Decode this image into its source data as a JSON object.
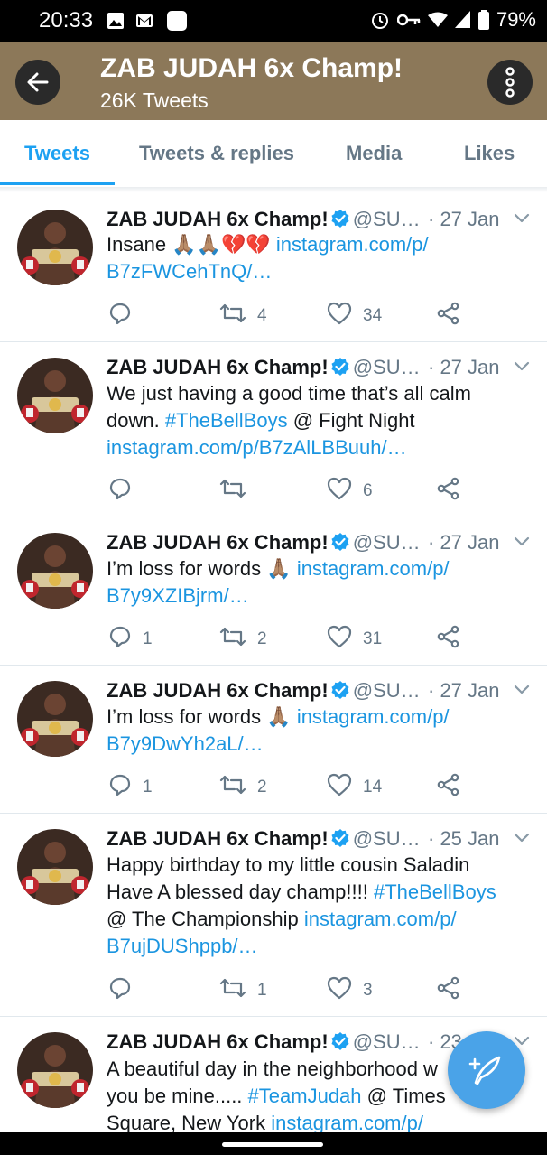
{
  "status_bar": {
    "time": "20:33",
    "battery": "79%"
  },
  "header": {
    "title": "ZAB JUDAH 6x Champ!",
    "subtitle": "26K Tweets"
  },
  "tabs": [
    {
      "label": "Tweets",
      "active": true
    },
    {
      "label": "Tweets & replies",
      "active": false
    },
    {
      "label": "Media",
      "active": false
    },
    {
      "label": "Likes",
      "active": false
    }
  ],
  "colors": {
    "header_bg": "#8c7859",
    "accent": "#1da1f2",
    "link": "#1b95e0",
    "muted": "#657786"
  },
  "tweets": [
    {
      "name": "ZAB JUDAH 6x Champ!",
      "handle": "@SU…",
      "date": "· 27 Jan",
      "line1_text": "Insane",
      "emoji": "🙏🏽🙏🏽💔💔",
      "line1_link": "instagram.com/p/",
      "line2_link": "B7zFWCehTnQ/…",
      "replies": "",
      "retweets": "4",
      "likes": "34"
    },
    {
      "name": "ZAB JUDAH 6x Champ!",
      "handle": "@SU…",
      "date": "· 27 Jan",
      "line1_text": "We just having a good time that’s all calm",
      "line2_text": "down.",
      "hashtag": "#TheBellBoys",
      "line2_after": "@ Fight Night",
      "line3_link": "instagram.com/p/B7zAlLBBuuh/…",
      "replies": "",
      "retweets": "",
      "likes": "6"
    },
    {
      "name": "ZAB JUDAH 6x Champ!",
      "handle": "@SU…",
      "date": "· 27 Jan",
      "line1_text": "I’m loss for words",
      "emoji": "🙏🏽",
      "line1_link": "instagram.com/p/",
      "line2_link": "B7y9XZIBjrm/…",
      "replies": "1",
      "retweets": "2",
      "likes": "31"
    },
    {
      "name": "ZAB JUDAH 6x Champ!",
      "handle": "@SU…",
      "date": "· 27 Jan",
      "line1_text": "I’m loss for words",
      "emoji": "🙏🏽",
      "line1_link": "instagram.com/p/",
      "line2_link": "B7y9DwYh2aL/…",
      "replies": "1",
      "retweets": "2",
      "likes": "14"
    },
    {
      "name": "ZAB JUDAH 6x Champ!",
      "handle": "@SU…",
      "date": "· 25 Jan",
      "line1_text": "Happy birthday to my little cousin Saladin",
      "line2_text": "Have A blessed day champ!!!!",
      "hashtag": "#TheBellBoys",
      "line3_text": "@ The Championship",
      "line3_link": "instagram.com/p/",
      "line4_link": "B7ujDUShppb/…",
      "replies": "",
      "retweets": "1",
      "likes": "3"
    },
    {
      "name": "ZAB JUDAH 6x Champ!",
      "handle": "@SU…",
      "date": "· 23",
      "line1_text": "A beautiful day in the neighborhood w",
      "line2_text": "you be mine.....",
      "hashtag": "#TeamJudah",
      "line2_after": "@ Times",
      "line3_text": "Square, New York",
      "line3_link": "instagram.com/p/"
    }
  ],
  "icons": {
    "back": "arrow-left-icon",
    "more": "more-vertical-icon",
    "compose": "compose-feather-icon"
  }
}
